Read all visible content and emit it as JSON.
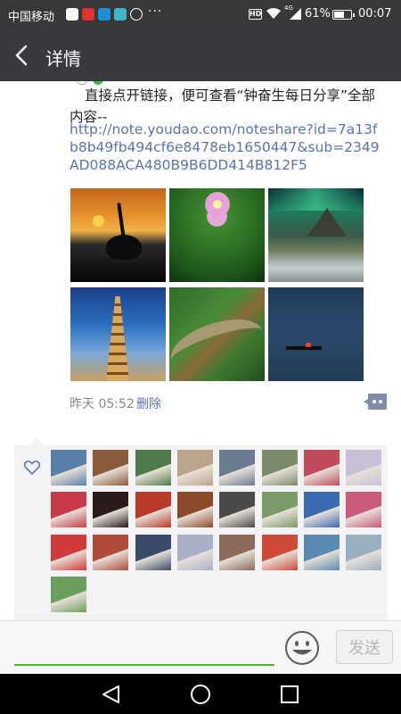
{
  "status_bar": {
    "carrier": "中国移动",
    "hd_label": "HD",
    "network_type": "4G",
    "battery_percent": "61%",
    "battery_level": 0.61,
    "time": "00:07",
    "overflow": "···"
  },
  "title_bar": {
    "title": "详情"
  },
  "post": {
    "text": "直接点开链接，便可查看“钟奋生每日分享”全部内容--",
    "link": "http://note.youdao.com/noteshare?id=7a13fb8b49fb494cf6e8478eb1650447&sub=2349AD088ACA480B9B6DD414B812F5",
    "time": "昨天 05:52",
    "delete_label": "删除",
    "photos": [
      {
        "subject": "crane-at-sunset"
      },
      {
        "subject": "lantana-flower-and-leaves"
      },
      {
        "subject": "aurora-mountain-waterfall"
      },
      {
        "subject": "pagoda"
      },
      {
        "subject": "river-landscape"
      },
      {
        "subject": "boat-on-water"
      }
    ]
  },
  "likes": {
    "count": 25,
    "colors": [
      "#5a7fa8",
      "#8a5a3c",
      "#4f7a4a",
      "#b8a58a",
      "#6a7a8f",
      "#7a8a6a",
      "#c04a5a",
      "#c8c0d8",
      "#c83a4a",
      "#2a1a1a",
      "#b83a2a",
      "#8a4a2a",
      "#4a4a4a",
      "#7a9a6a",
      "#3a6ab0",
      "#c85a7a",
      "#d03a3a",
      "#b04a3a",
      "#3a4a6a",
      "#a8b0c8",
      "#8a6a5a",
      "#d04a3a",
      "#5a8ab0",
      "#9ab0c0",
      "#6aa05a"
    ]
  },
  "input": {
    "placeholder": "",
    "send_label": "发送"
  },
  "colors": {
    "title_bar": "#393a3f",
    "status_bar": "#383838",
    "link": "#5b73a8",
    "accent_green": "#45c01a",
    "likes_bg": "#f3f3f5"
  },
  "icons": [
    "back-arrow-icon",
    "comment-icon",
    "heart-icon",
    "emoji-icon",
    "nav-back-icon",
    "nav-home-icon",
    "nav-recents-icon"
  ]
}
